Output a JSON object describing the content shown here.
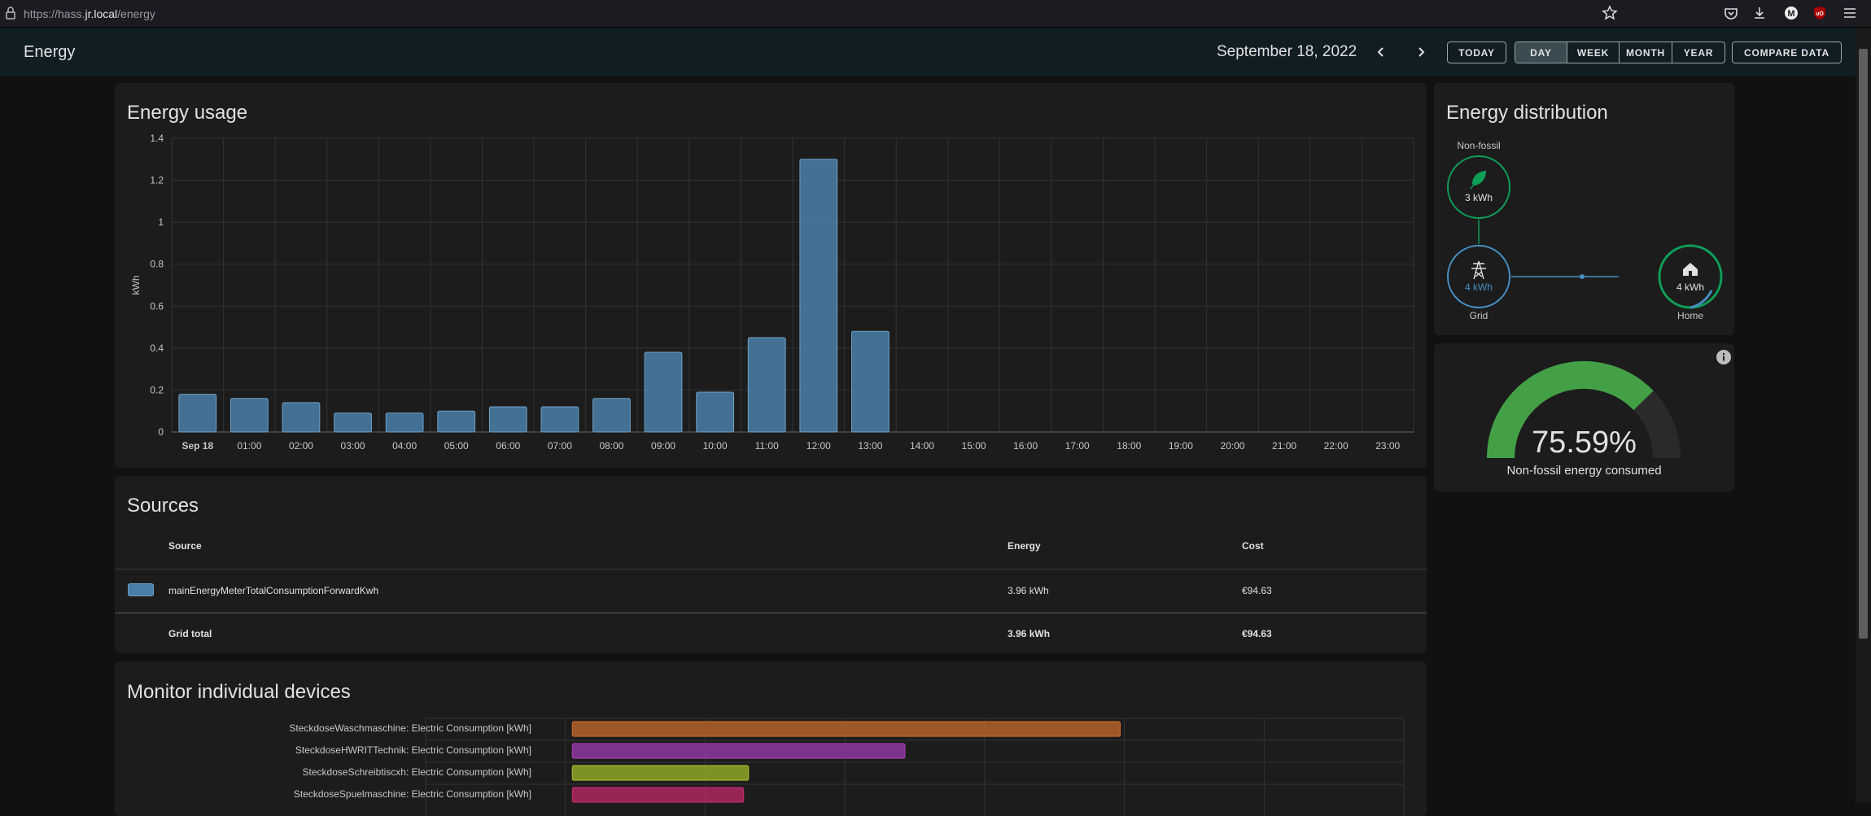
{
  "browser": {
    "url_prefix": "https://hass.",
    "url_domain": "jr.local",
    "url_path": "/energy"
  },
  "header": {
    "title": "Energy",
    "date": "September 18, 2022",
    "today_label": "TODAY",
    "periods": [
      "DAY",
      "WEEK",
      "MONTH",
      "YEAR"
    ],
    "active_period": "DAY",
    "compare_label": "COMPARE DATA"
  },
  "energy_usage": {
    "title": "Energy usage",
    "chart_data": {
      "type": "bar",
      "ylabel": "kWh",
      "ylim": [
        0,
        1.4
      ],
      "yticks": [
        "0",
        "0.2",
        "0.4",
        "0.6",
        "0.8",
        "1",
        "1.2",
        "1.4"
      ],
      "categories": [
        "Sep 18",
        "01:00",
        "02:00",
        "03:00",
        "04:00",
        "05:00",
        "06:00",
        "07:00",
        "08:00",
        "09:00",
        "10:00",
        "11:00",
        "12:00",
        "13:00",
        "14:00",
        "15:00",
        "16:00",
        "17:00",
        "18:00",
        "19:00",
        "20:00",
        "21:00",
        "22:00",
        "23:00"
      ],
      "values": [
        0.18,
        0.16,
        0.14,
        0.09,
        0.09,
        0.1,
        0.12,
        0.12,
        0.16,
        0.38,
        0.19,
        0.45,
        1.3,
        0.48,
        null,
        null,
        null,
        null,
        null,
        null,
        null,
        null,
        null,
        null
      ],
      "grid": true,
      "color": "#4a7fa8"
    }
  },
  "distribution": {
    "title": "Energy distribution",
    "nonfossil_label": "Non-fossil",
    "nonfossil_value": "3 kWh",
    "grid_label": "Grid",
    "grid_value": "4 kWh",
    "home_label": "Home",
    "home_value": "4 kWh",
    "colors": {
      "nonfossil": "#0f9d58",
      "grid": "#488fc2",
      "home": "#488fc2"
    }
  },
  "gauge": {
    "value_text": "75.59%",
    "value": 75.59,
    "label": "Non-fossil energy consumed",
    "color": "#43a047"
  },
  "sources": {
    "title": "Sources",
    "columns": {
      "source": "Source",
      "energy": "Energy",
      "cost": "Cost"
    },
    "rows": [
      {
        "name": "mainEnergyMeterTotalConsumptionForwardKwh",
        "energy": "3.96 kWh",
        "cost": "€94.63",
        "color": "#4a7fa8"
      }
    ],
    "total": {
      "label": "Grid total",
      "energy": "3.96 kWh",
      "cost": "€94.63"
    }
  },
  "devices": {
    "title": "Monitor individual devices",
    "chart_data": {
      "type": "bar",
      "orientation": "horizontal",
      "categories": [
        "SteckdoseWaschmaschine: Electric Consumption [kWh]",
        "SteckdoseHWRITTechnik: Electric Consumption [kWh]",
        "SteckdoseSchreibtiscxh: Electric Consumption [kWh]",
        "SteckdoseSpuelmaschine: Electric Consumption [kWh]"
      ],
      "values": [
        1.12,
        0.68,
        0.36,
        0.35
      ],
      "colors": [
        "#c8692b",
        "#9c3bb0",
        "#9cb82a",
        "#c02a6a"
      ]
    }
  }
}
